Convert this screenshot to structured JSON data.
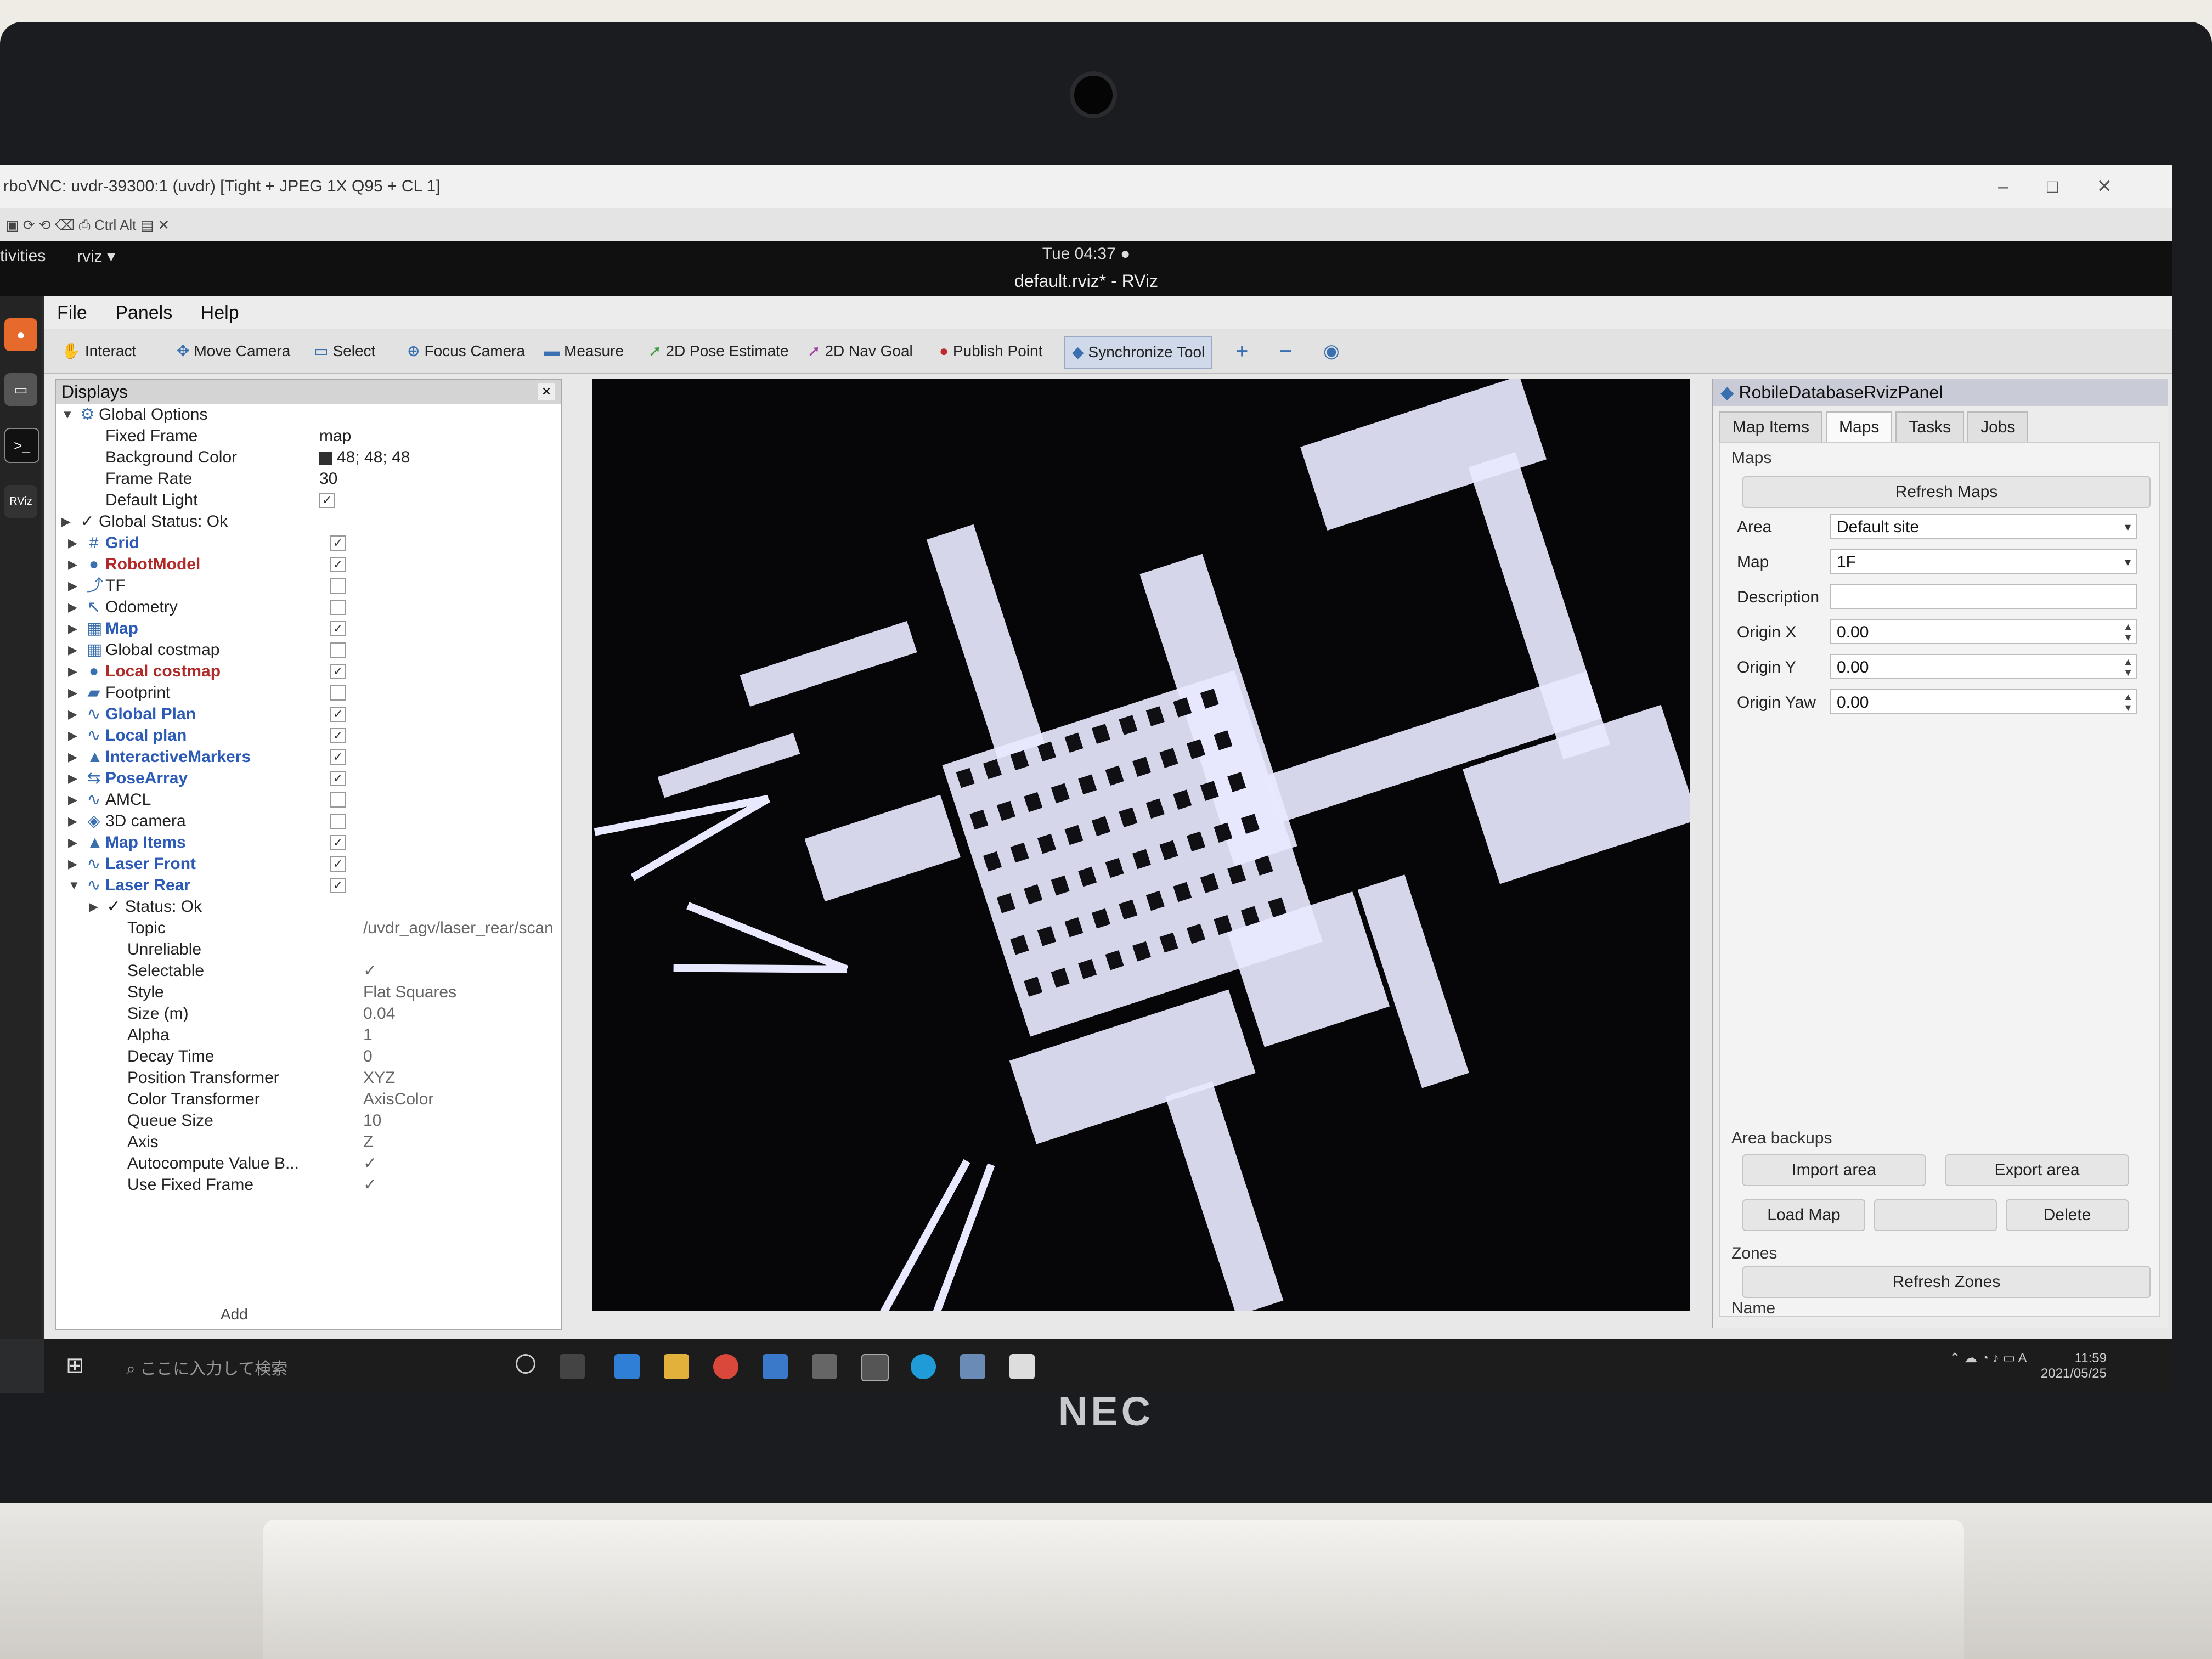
{
  "vnc": {
    "title": "rboVNC: uvdr-39300:1 (uvdr) [Tight + JPEG 1X Q95 + CL 1]",
    "toolbar_text": "Ctrl  Alt"
  },
  "gnome": {
    "activities": "tivities",
    "app_name": "rviz",
    "clock": "Tue 04:37 ●",
    "window_title": "default.rviz* - RViz"
  },
  "dock": {
    "rviz_label": "RViz"
  },
  "menu": {
    "file": "File",
    "panels": "Panels",
    "help": "Help"
  },
  "toolbar": {
    "interact": "Interact",
    "move_camera": "Move Camera",
    "select": "Select",
    "focus_camera": "Focus Camera",
    "measure": "Measure",
    "pose_estimate": "2D Pose Estimate",
    "nav_goal": "2D Nav Goal",
    "publish_point": "Publish Point",
    "sync_tool": "Synchronize Tool"
  },
  "displays": {
    "title": "Displays",
    "global_options": "Global Options",
    "fixed_frame_label": "Fixed Frame",
    "fixed_frame": "map",
    "bg_color_label": "Background Color",
    "bg_color": "48; 48; 48",
    "frame_rate_label": "Frame Rate",
    "frame_rate": "30",
    "default_light_label": "Default Light",
    "global_status": "Global Status: Ok",
    "items": [
      {
        "label": "Grid",
        "style": "blue",
        "checked": true
      },
      {
        "label": "RobotModel",
        "style": "red",
        "checked": true
      },
      {
        "label": "TF",
        "style": "",
        "checked": false
      },
      {
        "label": "Odometry",
        "style": "",
        "checked": false
      },
      {
        "label": "Map",
        "style": "blue",
        "checked": true
      },
      {
        "label": "Global costmap",
        "style": "",
        "checked": false
      },
      {
        "label": "Local costmap",
        "style": "red",
        "checked": true
      },
      {
        "label": "Footprint",
        "style": "",
        "checked": false
      },
      {
        "label": "Global Plan",
        "style": "blue",
        "checked": true
      },
      {
        "label": "Local plan",
        "style": "blue",
        "checked": true
      },
      {
        "label": "InteractiveMarkers",
        "style": "blue",
        "checked": true
      },
      {
        "label": "PoseArray",
        "style": "blue",
        "checked": true
      },
      {
        "label": "AMCL",
        "style": "",
        "checked": false
      },
      {
        "label": "3D camera",
        "style": "",
        "checked": false
      },
      {
        "label": "Map Items",
        "style": "blue",
        "checked": true
      },
      {
        "label": "Laser Front",
        "style": "blue",
        "checked": true
      },
      {
        "label": "Laser Rear",
        "style": "blue",
        "checked": true
      }
    ],
    "laser_rear": {
      "status": "Status: Ok",
      "props": [
        {
          "label": "Topic",
          "value": "/uvdr_agv/laser_rear/scan"
        },
        {
          "label": "Unreliable",
          "value": ""
        },
        {
          "label": "Selectable",
          "value": "✓"
        },
        {
          "label": "Style",
          "value": "Flat Squares"
        },
        {
          "label": "Size (m)",
          "value": "0.04"
        },
        {
          "label": "Alpha",
          "value": "1"
        },
        {
          "label": "Decay Time",
          "value": "0"
        },
        {
          "label": "Position Transformer",
          "value": "XYZ"
        },
        {
          "label": "Color Transformer",
          "value": "AxisColor"
        },
        {
          "label": "Queue Size",
          "value": "10"
        },
        {
          "label": "Axis",
          "value": "Z"
        },
        {
          "label": "Autocompute Value B...",
          "value": "✓"
        },
        {
          "label": "Use Fixed Frame",
          "value": "✓"
        }
      ]
    },
    "add_button": "Add"
  },
  "panel": {
    "title": "RobileDatabaseRvizPanel",
    "tabs": [
      "Map Items",
      "Maps",
      "Tasks",
      "Jobs"
    ],
    "maps_section": "Maps",
    "refresh_maps": "Refresh Maps",
    "area_label": "Area",
    "area_value": "Default site",
    "map_label": "Map",
    "map_value": "1F",
    "description_label": "Description",
    "description_value": "",
    "origin_x_label": "Origin X",
    "origin_x": "0.00",
    "origin_y_label": "Origin Y",
    "origin_y": "0.00",
    "origin_yaw_label": "Origin Yaw",
    "origin_yaw": "0.00",
    "area_backups": "Area backups",
    "import_area": "Import area",
    "export_area": "Export area",
    "load_map": "Load Map",
    "delete": "Delete",
    "zones": "Zones",
    "refresh_zones": "Refresh Zones",
    "name_label": "Name"
  },
  "taskbar": {
    "search_placeholder": "ここに入力して検索",
    "time": "11:59",
    "date": "2021/05/25",
    "ime": "A"
  },
  "laptop": {
    "brand": "NEC"
  },
  "colors": {
    "accent": "#2c5bb7",
    "error": "#b02a2a",
    "viewport_bg": "#060608",
    "map_free": "#e8e8ff"
  }
}
